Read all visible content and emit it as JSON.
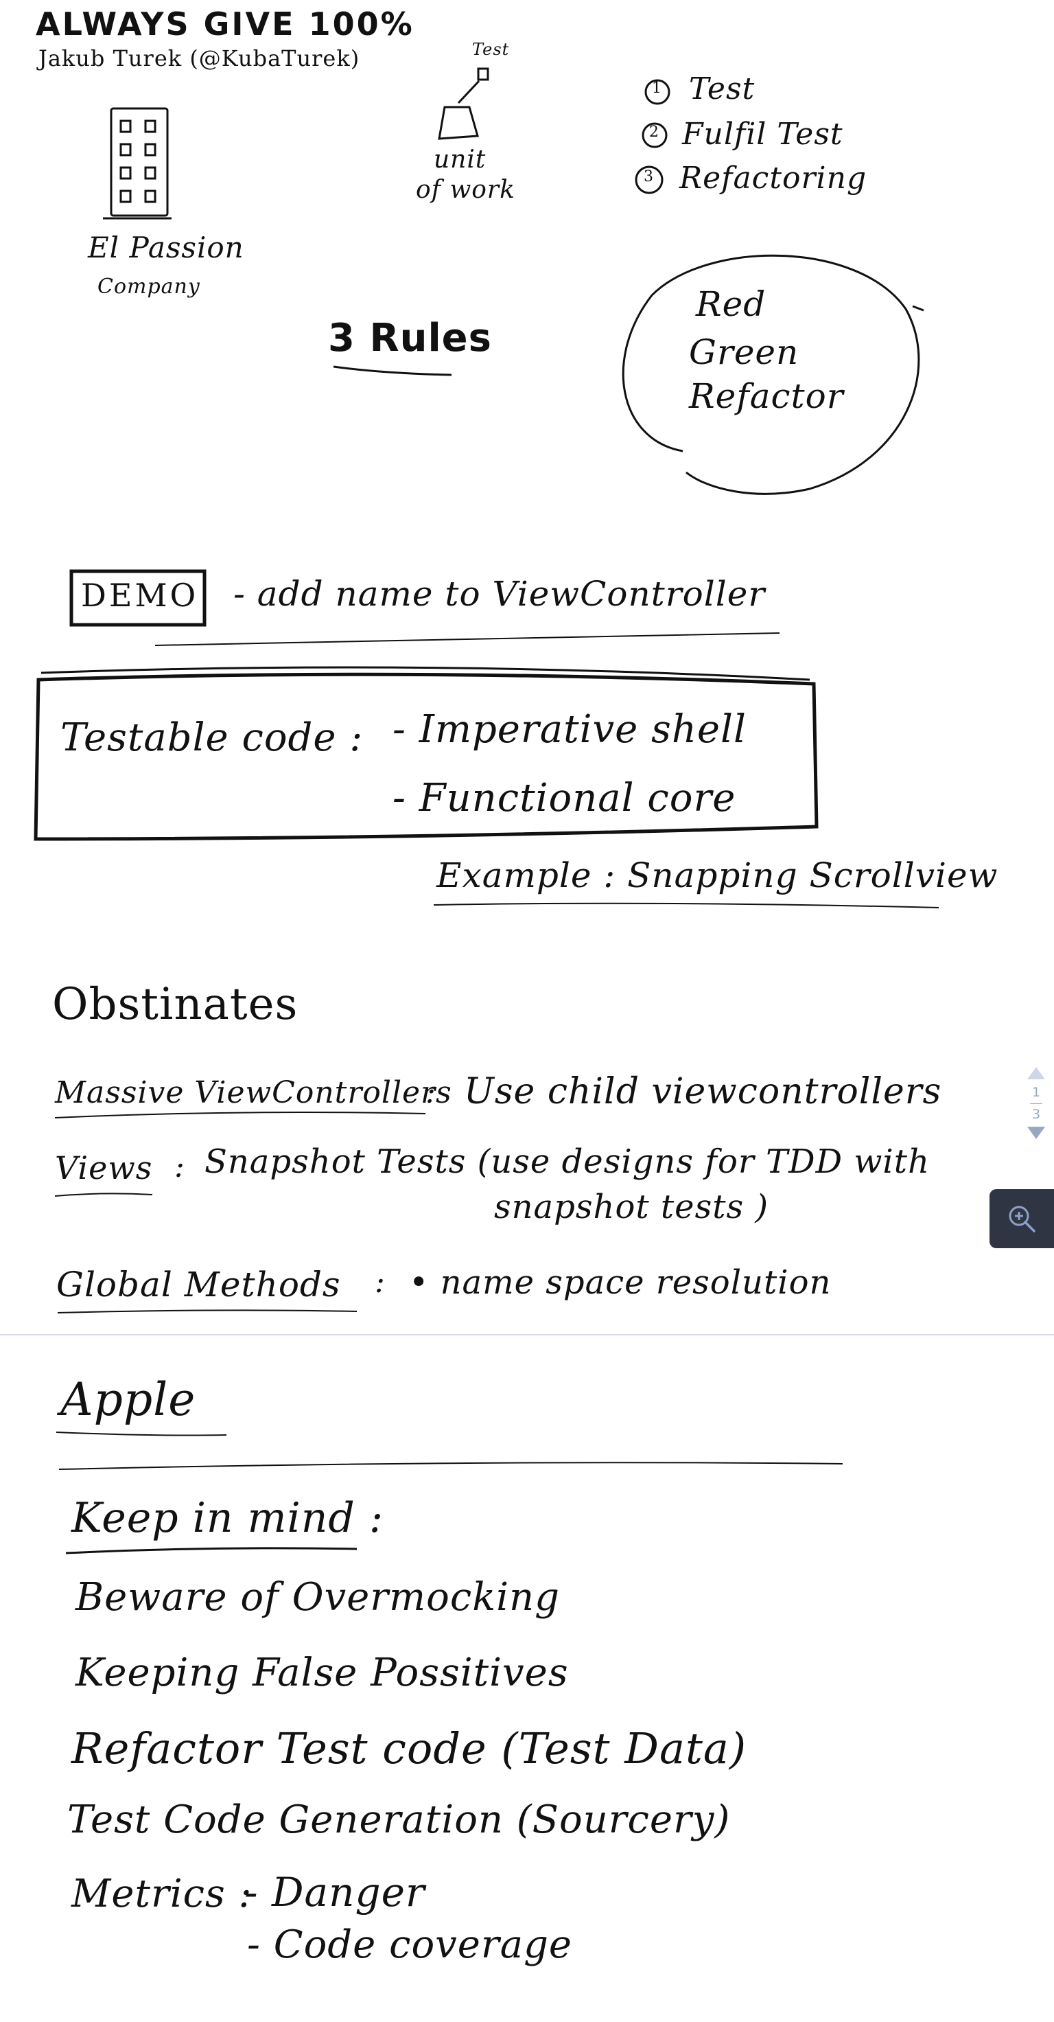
{
  "header": {
    "title": "ALWAYS GIVE 100%",
    "author": "Jakub Turek (@KubaTurek)"
  },
  "page1": {
    "company_label_1": "El Passion",
    "company_label_2": "Company",
    "test_label": "Test",
    "unit_of_work_1": "unit",
    "unit_of_work_2": "of work",
    "steps": [
      "Test",
      "Fulfil Test",
      "Refactoring"
    ],
    "step_numbers": [
      "1",
      "2",
      "3"
    ],
    "rules_title": "3 Rules",
    "cycle": [
      "Red",
      "Green",
      "Refactor"
    ],
    "demo_box": "DEMO",
    "demo_text": "- add name to ViewController",
    "testable_code_label": "Testable code :",
    "testable_items": [
      "- Imperative shell",
      "- Functional core"
    ],
    "example_text": "Example : Snapping Scrollview",
    "obstinates_title": "Obstinates",
    "obstinates": [
      {
        "term": "Massive ViewControllers",
        "sep": ":",
        "solution": "Use child viewcontrollers"
      },
      {
        "term": "Views",
        "sep": ":",
        "solution": "Snapshot Tests (use designs for TDD with"
      },
      {
        "term": "Global Methods",
        "sep": ":",
        "solution": "• name space resolution"
      }
    ],
    "views_continuation": "snapshot tests )"
  },
  "page2": {
    "apple_title": "Apple",
    "keep_in_mind_title": "Keep in mind :",
    "items": [
      "Beware of Overmocking",
      "Keeping False Possitives",
      "Refactor Test code (Test Data)",
      "Test Code Generation (Sourcery)"
    ],
    "metrics_label": "Metrics :",
    "metrics_items": [
      "- Danger",
      "- Code coverage"
    ]
  },
  "navigation": {
    "current_page": "1",
    "total_pages": "3",
    "up_icon": "chevron-up-icon",
    "down_icon": "chevron-down-icon",
    "zoom_icon": "zoom-in-icon"
  },
  "colors": {
    "ink": "#111111",
    "nav": "#9aa7c2",
    "zoom_bg": "#2f3542",
    "divider": "#d6dbe4"
  }
}
